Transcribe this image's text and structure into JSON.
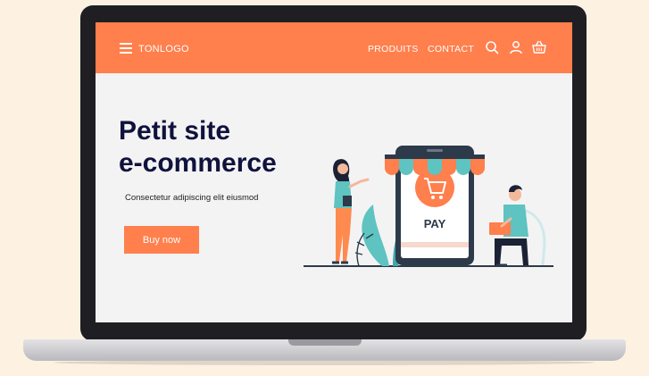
{
  "navbar": {
    "logo": "TONLOGO",
    "links": [
      {
        "label": "PRODUITS"
      },
      {
        "label": "CONTACT"
      }
    ],
    "icons": [
      "search-icon",
      "user-icon",
      "basket-icon"
    ]
  },
  "hero": {
    "title_line1": "Petit site",
    "title_line2": "e-commerce",
    "subtitle": "Consectetur adipiscing elit eiusmod",
    "cta": "Buy now"
  },
  "illustration": {
    "pay_label": "PAY"
  },
  "colors": {
    "accent": "#ff7f4d",
    "heading": "#10123d",
    "teal": "#5ec3c1",
    "dark": "#2d3a4a"
  }
}
